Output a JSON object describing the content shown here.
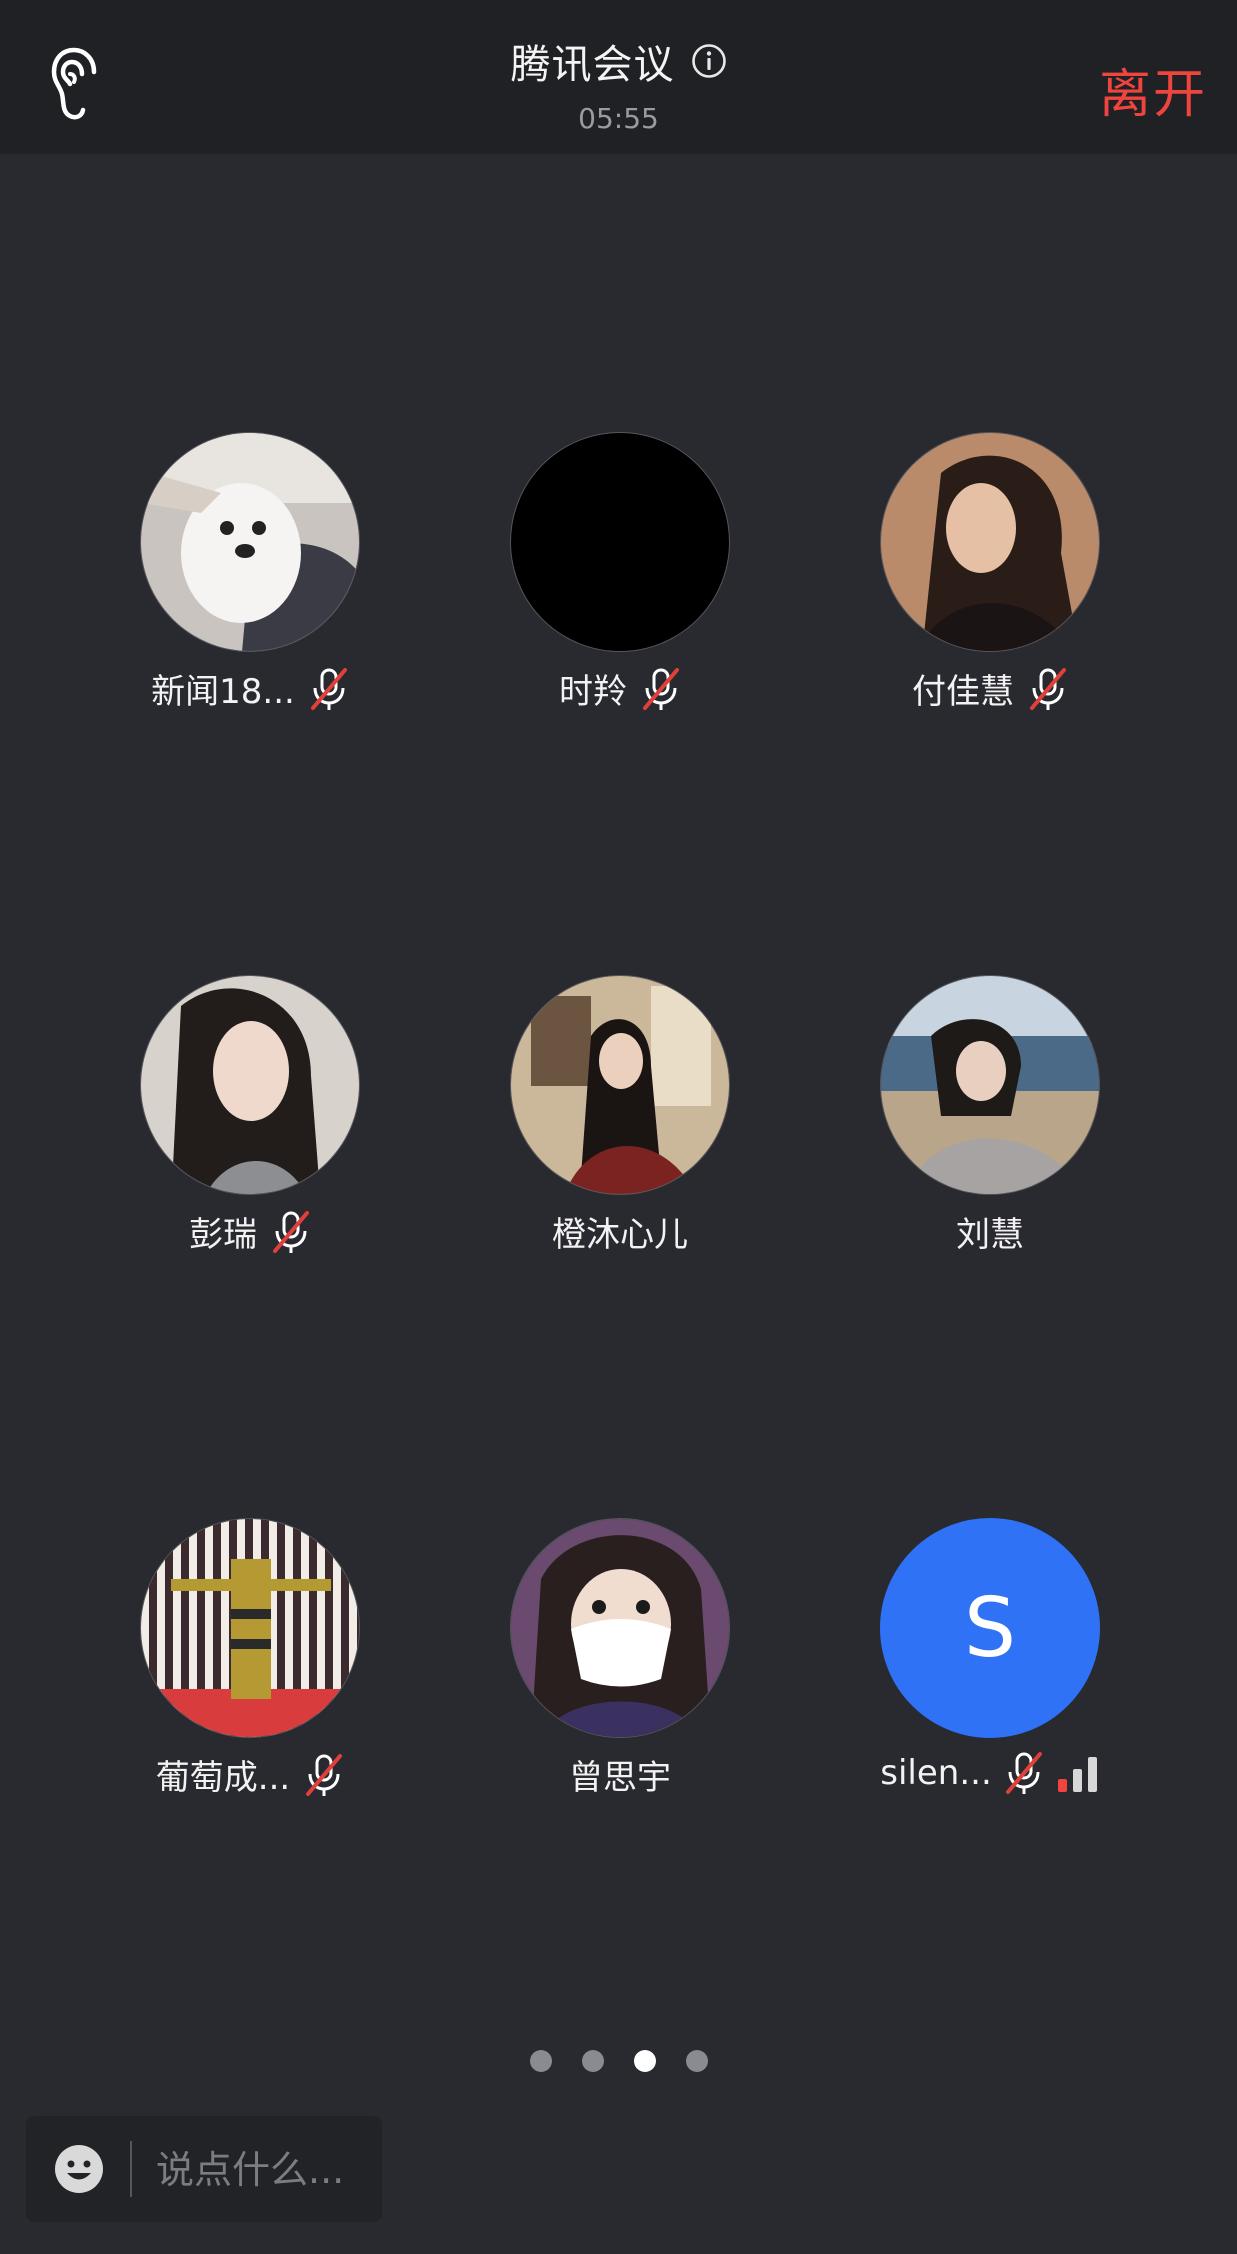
{
  "header": {
    "title": "腾讯会议",
    "timer": "05:55",
    "leave_label": "离开",
    "earpiece_icon": "ear-icon",
    "info_icon": "info-icon"
  },
  "participants": [
    {
      "name": "新闻18...",
      "muted": true,
      "avatar": "dog-photo"
    },
    {
      "name": "时羚",
      "muted": true,
      "avatar": "black-circle"
    },
    {
      "name": "付佳慧",
      "muted": true,
      "avatar": "photo"
    },
    {
      "name": "彭瑞",
      "muted": true,
      "avatar": "photo"
    },
    {
      "name": "橙沐心儿",
      "muted": false,
      "avatar": "photo"
    },
    {
      "name": "刘慧",
      "muted": false,
      "avatar": "photo"
    },
    {
      "name": "葡萄成...",
      "muted": true,
      "avatar": "photo"
    },
    {
      "name": "曾思宇",
      "muted": false,
      "avatar": "photo"
    },
    {
      "name": "silen...",
      "muted": true,
      "avatar": "letter",
      "letter": "S",
      "signal": "weak"
    }
  ],
  "pagination": {
    "pages": 4,
    "current": 3
  },
  "chat": {
    "placeholder": "说点什么..."
  },
  "colors": {
    "background": "#292a30",
    "topbar": "#202125",
    "leave": "#f0453e",
    "avatar_letter_bg": "#2f72f6",
    "mute_slash": "#e0403a"
  }
}
